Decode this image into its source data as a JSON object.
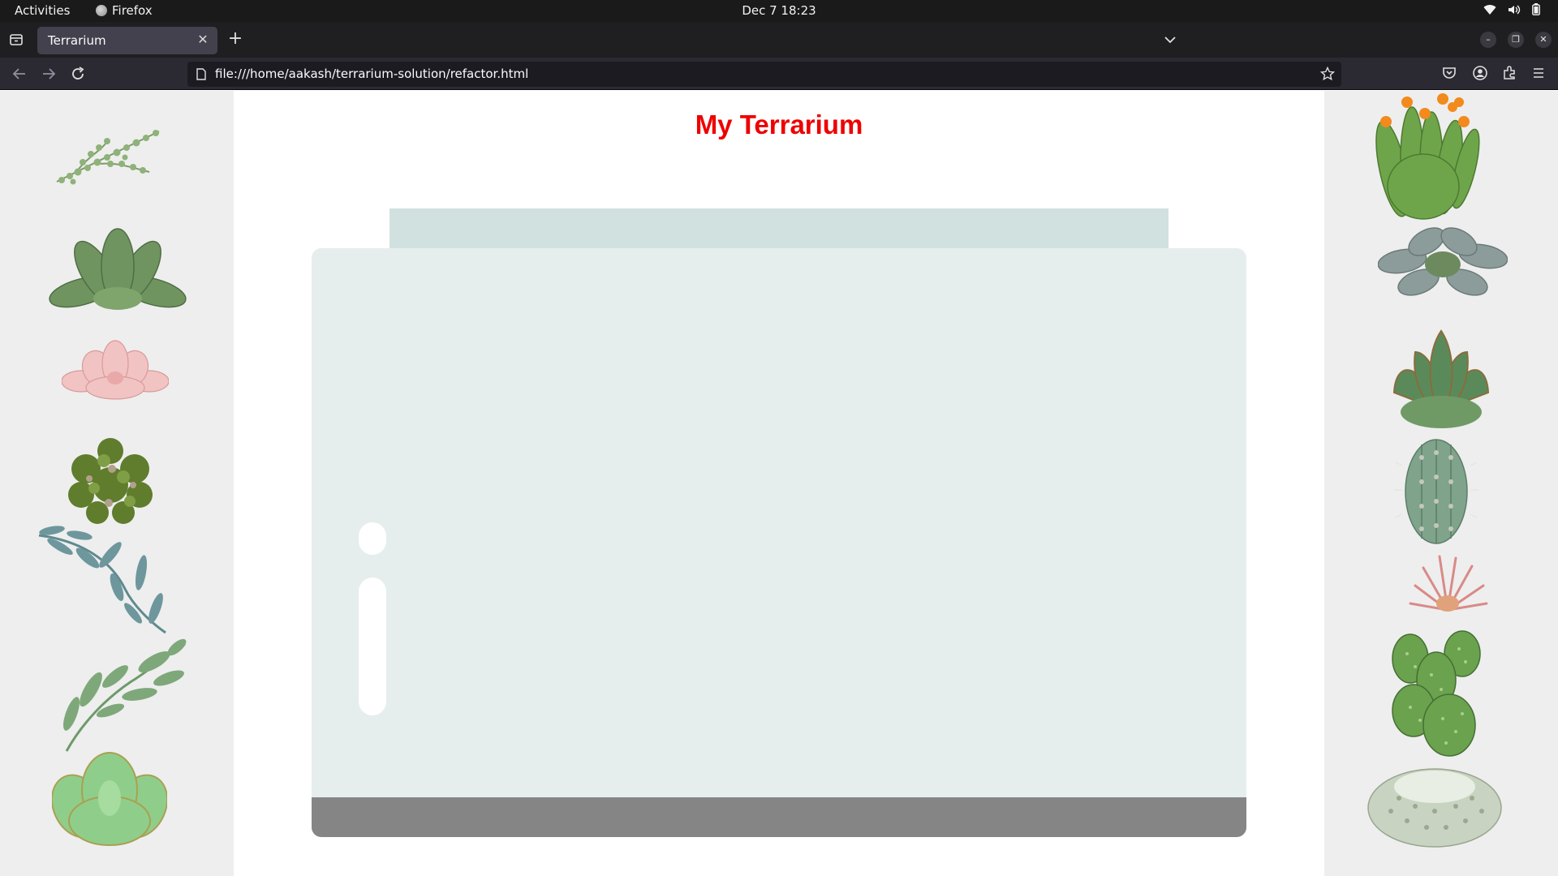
{
  "system": {
    "activities": "Activities",
    "app_name": "Firefox",
    "clock": "Dec 7  18:23"
  },
  "browser": {
    "tab_title": "Terrarium",
    "url": "file:///home/aakash/terrarium-solution/refactor.html"
  },
  "page": {
    "title": "My Terrarium"
  },
  "colors": {
    "title": "#ee0000",
    "sidebar": "#eeeeee",
    "jar_top": "#d1e1df",
    "jar_walls": "#e6eeed",
    "dirt": "#858585"
  },
  "plants": {
    "left": [
      "plant1",
      "plant2",
      "plant3",
      "plant4",
      "plant5",
      "plant6",
      "plant7"
    ],
    "right": [
      "plant8",
      "plant9",
      "plant10",
      "plant11",
      "plant12",
      "plant13",
      "plant14"
    ]
  }
}
